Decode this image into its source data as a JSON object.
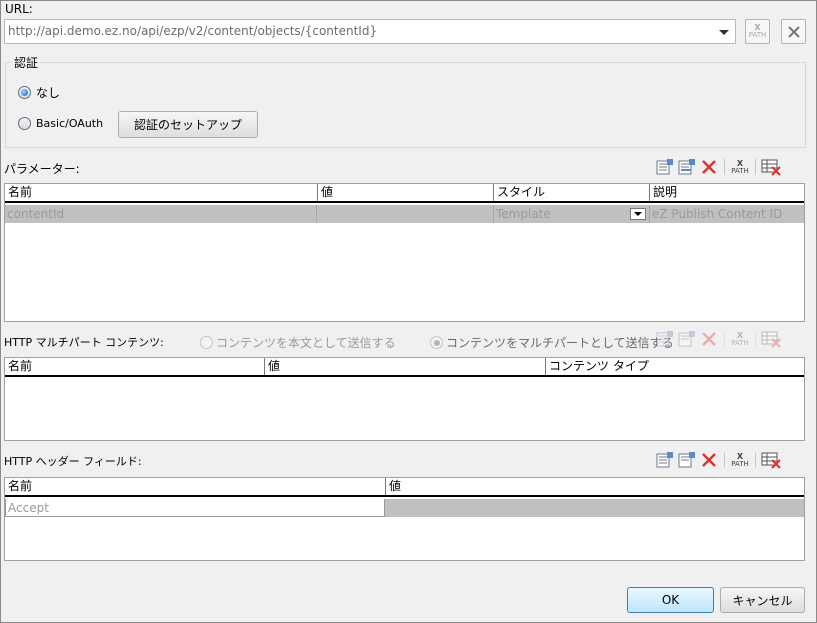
{
  "url": {
    "label": "URL:",
    "value": "http://api.demo.ez.no/api/ezp/v2/content/objects/{contentId}"
  },
  "xpath_icon_text": {
    "top": "X",
    "bottom": "PATH"
  },
  "auth": {
    "title": "認証",
    "option_none": "なし",
    "option_basic": "Basic/OAuth",
    "setup_button": "認証のセットアップ",
    "selected": "none"
  },
  "parameters": {
    "label": "パラメーター:",
    "columns": [
      "名前",
      "値",
      "スタイル",
      "説明"
    ],
    "rows": [
      {
        "name": "contentId",
        "value": "",
        "style": "Template",
        "description": "eZ Publish Content ID"
      }
    ]
  },
  "multipart": {
    "label": "HTTP マルチパート コンテンツ:",
    "option_body": "コンテンツを本文として送信する",
    "option_multipart": "コンテンツをマルチパートとして送信する",
    "selected": "multipart",
    "columns": [
      "名前",
      "値",
      "コンテンツ タイプ"
    ],
    "rows": []
  },
  "headers": {
    "label": "HTTP ヘッダー フィールド:",
    "columns": [
      "名前",
      "値"
    ],
    "rows": [
      {
        "name": "Accept",
        "value": ""
      }
    ]
  },
  "buttons": {
    "ok": "OK",
    "cancel": "キャンセル"
  },
  "colors": {
    "delete_red": "#e03030",
    "row_grey": "#c0c0c0",
    "ok_border": "#3c7fb1"
  }
}
